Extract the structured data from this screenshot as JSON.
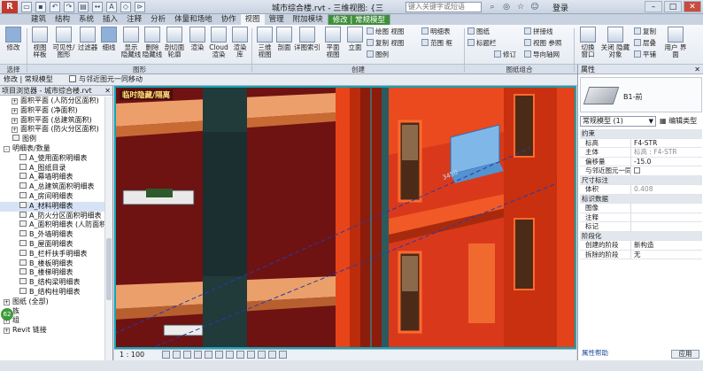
{
  "app": {
    "logo": "R",
    "window_title": "城市综合楼.rvt - 三维视图: {三维}",
    "search_placeholder": "键入关键字或短语",
    "login": "登录"
  },
  "qat_icons": [
    "open-icon",
    "save-icon",
    "undo-icon",
    "redo-icon",
    "print-icon",
    "measure-icon",
    "text-icon",
    "3d-icon",
    "section-icon"
  ],
  "tabs": [
    "建筑",
    "结构",
    "系统",
    "插入",
    "注释",
    "分析",
    "体量和场地",
    "协作",
    "视图",
    "管理",
    "附加模块",
    "修改 | 常规模型"
  ],
  "active_tab": "修改 | 常规模型",
  "ribbon": {
    "big_buttons": [
      "修改",
      "视图\n样板",
      "可见性/\n图形",
      "过滤器",
      "细线",
      "显示\n隐藏线",
      "删除\n隐藏线",
      "剖切面\n轮廓",
      "渲染",
      "Cloud\n渲染",
      "渲染\n库",
      "三维\n视图",
      "剖面",
      "详图索引",
      "平面\n视图",
      "立面",
      "图纸",
      "切换\n窗口",
      "关闭\n隐藏对象",
      "用户\n界面"
    ],
    "small_buttons": [
      "绘图 视图",
      "复制 视图",
      "图例",
      "明细表",
      "范围 框",
      "图纸",
      "标题栏",
      "修订",
      "拼接线",
      "视图 参照",
      "导向轴网",
      "视图",
      "复制",
      "层叠",
      "平铺"
    ],
    "panels": [
      "选择",
      "图形",
      "创建",
      "图纸组合",
      "窗口"
    ]
  },
  "options_bar": {
    "mode": "修改 | 常规模型",
    "checkbox": "与邻近图元一同移动"
  },
  "browser": {
    "title": "项目浏览器 - 城市综合楼.rvt",
    "items": [
      {
        "label": "面积平面 (人防分区面积)",
        "level": 1,
        "toggle": "+"
      },
      {
        "label": "面积平面 (净面积)",
        "level": 1,
        "toggle": "+"
      },
      {
        "label": "面积平面 (总建筑面积)",
        "level": 1,
        "toggle": "+"
      },
      {
        "label": "面积平面 (防火分区面积)",
        "level": 1,
        "toggle": "+"
      },
      {
        "label": "图例",
        "level": 0,
        "toggle": ""
      },
      {
        "label": "明细表/数量",
        "level": 0,
        "toggle": "-"
      },
      {
        "label": "A_使用面积明细表",
        "level": 2,
        "toggle": ""
      },
      {
        "label": "A_图纸目录",
        "level": 2,
        "toggle": ""
      },
      {
        "label": "A_幕墙明细表",
        "level": 2,
        "toggle": ""
      },
      {
        "label": "A_总建筑面积明细表",
        "level": 2,
        "toggle": ""
      },
      {
        "label": "A_房间明细表",
        "level": 2,
        "toggle": ""
      },
      {
        "label": "A_材料明细表",
        "level": 2,
        "toggle": "",
        "selected": true
      },
      {
        "label": "A_防火分区面积明细表",
        "level": 2,
        "toggle": ""
      },
      {
        "label": "A_面积明细表 (人防面积)",
        "level": 2,
        "toggle": ""
      },
      {
        "label": "B_外墙明细表",
        "level": 2,
        "toggle": ""
      },
      {
        "label": "B_屋面明细表",
        "level": 2,
        "toggle": ""
      },
      {
        "label": "B_栏杆扶手明细表",
        "level": 2,
        "toggle": ""
      },
      {
        "label": "B_楼板明细表",
        "level": 2,
        "toggle": ""
      },
      {
        "label": "B_楼梯明细表",
        "level": 2,
        "toggle": ""
      },
      {
        "label": "B_结构梁明细表",
        "level": 2,
        "toggle": ""
      },
      {
        "label": "B_结构柱明细表",
        "level": 2,
        "toggle": ""
      },
      {
        "label": "图纸 (全部)",
        "level": 0,
        "toggle": "+"
      },
      {
        "label": "族",
        "level": 0,
        "toggle": "+"
      },
      {
        "label": "组",
        "level": 0,
        "toggle": "+"
      },
      {
        "label": "Revit 链接",
        "level": 0,
        "toggle": "+"
      }
    ],
    "badge": "62"
  },
  "viewport": {
    "label": "临时隐藏/隔离",
    "dimension": "3450"
  },
  "status": {
    "scale": "1 : 100"
  },
  "properties": {
    "title": "属性",
    "type_name": "B1-前",
    "type_selector": "常规模型 (1)",
    "edit_type": "编辑类型",
    "rows": [
      {
        "group": "约束"
      },
      {
        "key": "标高",
        "value": "F4-STR"
      },
      {
        "key": "主体",
        "value": "标高 : F4-STR",
        "gray": true
      },
      {
        "key": "偏移量",
        "value": "-15.0"
      },
      {
        "key": "与邻近图元一同...",
        "value": "",
        "checkbox": true
      },
      {
        "group": "尺寸标注"
      },
      {
        "key": "体积",
        "value": "0.408",
        "gray": true
      },
      {
        "group": "标识数据"
      },
      {
        "key": "图像",
        "value": ""
      },
      {
        "key": "注释",
        "value": ""
      },
      {
        "key": "标记",
        "value": ""
      },
      {
        "group": "阶段化"
      },
      {
        "key": "创建的阶段",
        "value": "新构造"
      },
      {
        "key": "拆除的阶段",
        "value": "无"
      }
    ],
    "help": "属性帮助",
    "apply": "应用"
  }
}
